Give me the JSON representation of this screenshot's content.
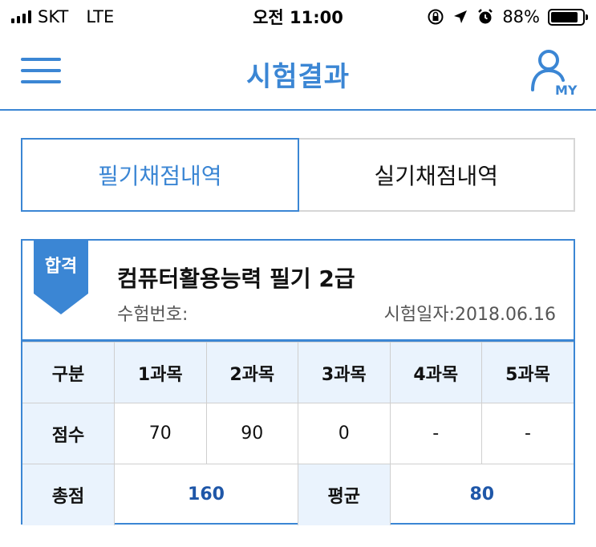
{
  "status_bar": {
    "carrier": "SKT",
    "network": "LTE",
    "time": "오전 11:00",
    "battery_percent": "88%",
    "battery_level": 0.88
  },
  "header": {
    "title": "시험결과",
    "menu_icon": "hamburger-menu-icon",
    "my_icon": "my-page-icon",
    "my_label": "MY"
  },
  "tabs": [
    {
      "label": "필기채점내역",
      "active": true
    },
    {
      "label": "실기채점내역",
      "active": false
    }
  ],
  "result": {
    "badge": "합격",
    "exam_name": "컴퓨터활용능력 필기 2급",
    "exam_number_label": "수험번호:",
    "exam_date_label": "시험일자:2018.06.16",
    "table": {
      "header": [
        "구분",
        "1과목",
        "2과목",
        "3과목",
        "4과목",
        "5과목"
      ],
      "score_label": "점수",
      "scores": [
        "70",
        "90",
        "0",
        "-",
        "-"
      ],
      "total_label": "총점",
      "total_value": "160",
      "average_label": "평균",
      "average_value": "80"
    }
  },
  "colors": {
    "accent": "#3b86d4",
    "header_bg": "#eaf3fd",
    "value_text": "#1f57a8"
  }
}
